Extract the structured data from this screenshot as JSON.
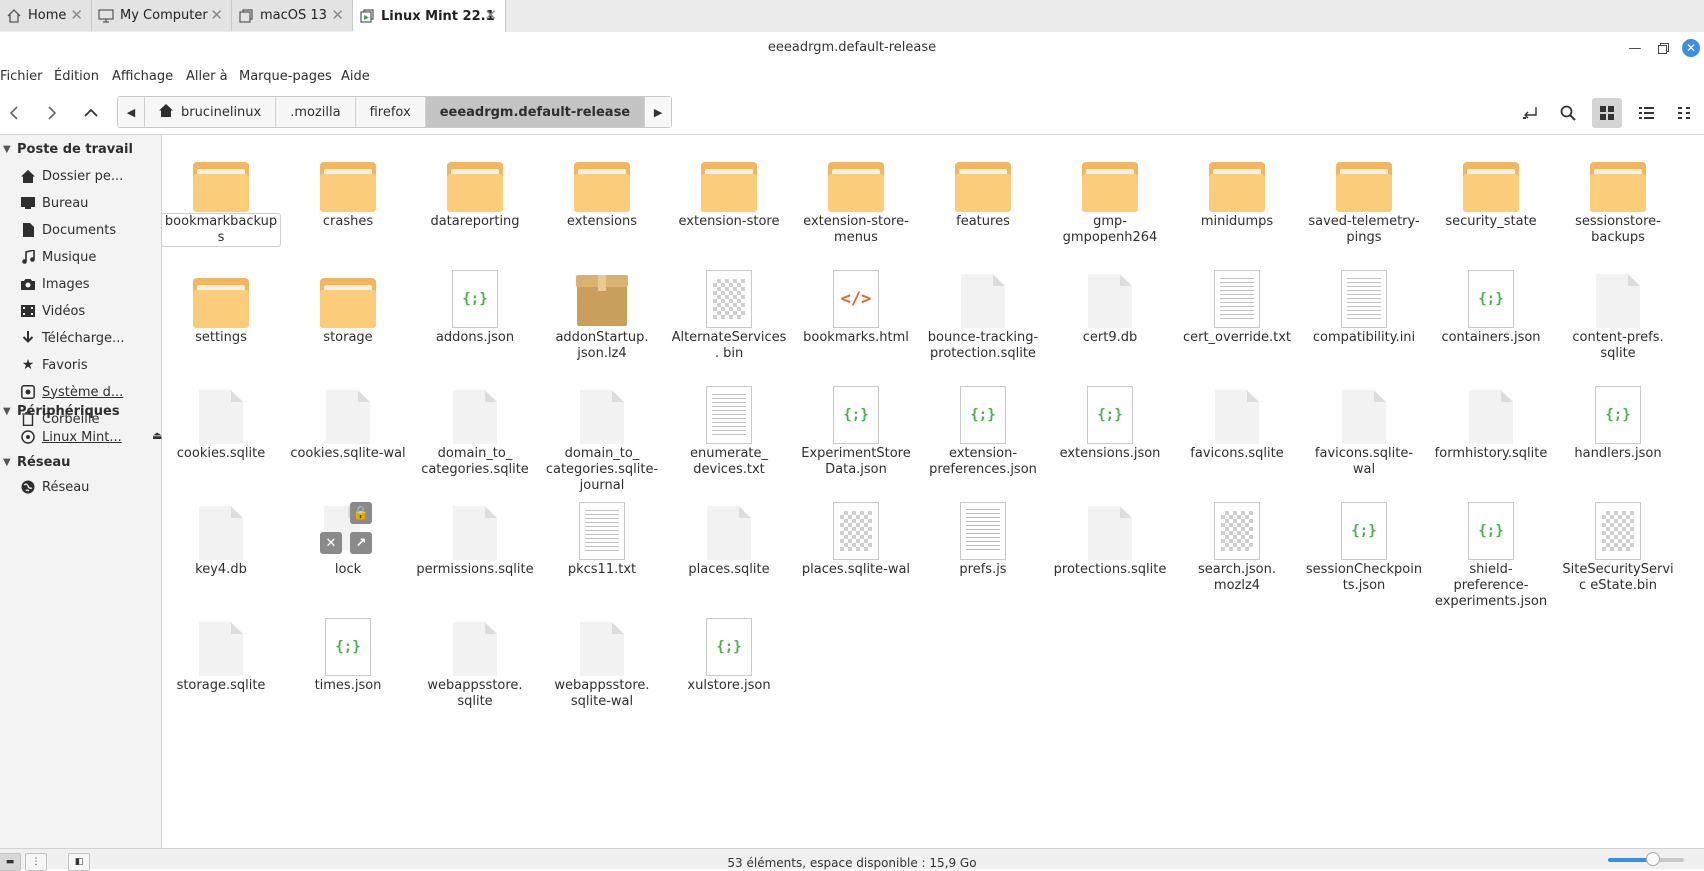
{
  "vm_tabs": [
    {
      "label": "Home",
      "icon": "home-icon"
    },
    {
      "label": "My Computer",
      "icon": "monitor-icon"
    },
    {
      "label": "macOS 13",
      "icon": "vm-icon"
    },
    {
      "label": "Linux Mint 22.1",
      "icon": "vm-running-icon"
    }
  ],
  "window": {
    "title": "eeeadrgm.default-release"
  },
  "menu": [
    "Fichier",
    "Édition",
    "Affichage",
    "Aller à",
    "Marque-pages",
    "Aide"
  ],
  "breadcrumbs": [
    "brucinelinux",
    ".mozilla",
    "firefox",
    "eeeadrgm.default-release"
  ],
  "sidebar": {
    "sections": [
      {
        "title": "Poste de travail",
        "items": [
          {
            "label": "Dossier pe...",
            "icon": "home-icon"
          },
          {
            "label": "Bureau",
            "icon": "desktop-icon"
          },
          {
            "label": "Documents",
            "icon": "document-icon"
          },
          {
            "label": "Musique",
            "icon": "music-icon"
          },
          {
            "label": "Images",
            "icon": "camera-icon"
          },
          {
            "label": "Vidéos",
            "icon": "video-icon"
          },
          {
            "label": "Télécharge...",
            "icon": "download-icon"
          },
          {
            "label": "Favoris",
            "icon": "star-icon"
          },
          {
            "label": "Système d...",
            "icon": "drive-icon"
          },
          {
            "label": "Corbeille",
            "icon": "trash-icon"
          }
        ]
      },
      {
        "title": "Périphériques",
        "items": [
          {
            "label": "Linux Mint...",
            "icon": "disc-icon"
          }
        ]
      },
      {
        "title": "Réseau",
        "items": [
          {
            "label": "Réseau",
            "icon": "network-icon"
          }
        ]
      }
    ]
  },
  "files": [
    {
      "name": "bookmarkbackups",
      "type": "folder"
    },
    {
      "name": "crashes",
      "type": "folder"
    },
    {
      "name": "datareporting",
      "type": "folder"
    },
    {
      "name": "extensions",
      "type": "folder"
    },
    {
      "name": "extension-store",
      "type": "folder"
    },
    {
      "name": "extension-store-menus",
      "type": "folder"
    },
    {
      "name": "features",
      "type": "folder"
    },
    {
      "name": "gmp-gmpopenh264",
      "type": "folder"
    },
    {
      "name": "minidumps",
      "type": "folder"
    },
    {
      "name": "saved-telemetry-pings",
      "type": "folder"
    },
    {
      "name": "security_state",
      "type": "folder"
    },
    {
      "name": "sessionstore-backups",
      "type": "folder"
    },
    {
      "name": "settings",
      "type": "folder"
    },
    {
      "name": "storage",
      "type": "folder"
    },
    {
      "name": "addons.json",
      "type": "json"
    },
    {
      "name": "addonStartup.json.lz4",
      "type": "archive"
    },
    {
      "name": "AlternateServices.bin",
      "type": "binary"
    },
    {
      "name": "bookmarks.html",
      "type": "html"
    },
    {
      "name": "bounce-tracking-protection.sqlite",
      "type": "blank"
    },
    {
      "name": "cert9.db",
      "type": "blank"
    },
    {
      "name": "cert_override.txt",
      "type": "text"
    },
    {
      "name": "compatibility.ini",
      "type": "text"
    },
    {
      "name": "containers.json",
      "type": "json"
    },
    {
      "name": "content-prefs.sqlite",
      "type": "blank"
    },
    {
      "name": "cookies.sqlite",
      "type": "blank"
    },
    {
      "name": "cookies.sqlite-wal",
      "type": "blank"
    },
    {
      "name": "domain_to_categories.sqlite",
      "type": "blank"
    },
    {
      "name": "domain_to_categories.sqlite-journal",
      "type": "blank"
    },
    {
      "name": "enumerate_devices.txt",
      "type": "text"
    },
    {
      "name": "ExperimentStoreData.json",
      "type": "json"
    },
    {
      "name": "extension-preferences.json",
      "type": "json"
    },
    {
      "name": "extensions.json",
      "type": "json"
    },
    {
      "name": "favicons.sqlite",
      "type": "blank"
    },
    {
      "name": "favicons.sqlite-wal",
      "type": "blank"
    },
    {
      "name": "formhistory.sqlite",
      "type": "blank"
    },
    {
      "name": "handlers.json",
      "type": "json"
    },
    {
      "name": "key4.db",
      "type": "blank"
    },
    {
      "name": "lock",
      "type": "lock"
    },
    {
      "name": "permissions.sqlite",
      "type": "blank"
    },
    {
      "name": "pkcs11.txt",
      "type": "text"
    },
    {
      "name": "places.sqlite",
      "type": "blank"
    },
    {
      "name": "places.sqlite-wal",
      "type": "binary"
    },
    {
      "name": "prefs.js",
      "type": "code"
    },
    {
      "name": "protections.sqlite",
      "type": "blank"
    },
    {
      "name": "search.json.mozlz4",
      "type": "binary"
    },
    {
      "name": "sessionCheckpoints.json",
      "type": "json"
    },
    {
      "name": "shield-preference-experiments.json",
      "type": "json"
    },
    {
      "name": "SiteSecurityServiceState.bin",
      "type": "binary"
    },
    {
      "name": "storage.sqlite",
      "type": "blank"
    },
    {
      "name": "times.json",
      "type": "json"
    },
    {
      "name": "webappsstore.sqlite",
      "type": "blank"
    },
    {
      "name": "webappsstore.sqlite-wal",
      "type": "blank"
    },
    {
      "name": "xulstore.json",
      "type": "json"
    }
  ],
  "display_names": {
    "bookmarkbackups": "bookmarkbackup s",
    "extension-store-menus": "extension-store- menus",
    "gmp-gmpopenh264": "gmp- gmpopenh264",
    "saved-telemetry-pings": "saved-telemetry- pings",
    "sessionstore-backups": "sessionstore- backups",
    "addonStartup.json.lz4": "addonStartup. json.lz4",
    "AlternateServices.bin": "AlternateServices. bin",
    "bounce-tracking-protection.sqlite": "bounce-tracking- protection.sqlite",
    "content-prefs.sqlite": "content-prefs. sqlite",
    "domain_to_categories.sqlite": "domain_to_ categories.sqlite",
    "domain_to_categories.sqlite-journal": "domain_to_ categories.sqlite- journal",
    "enumerate_devices.txt": "enumerate_ devices.txt",
    "ExperimentStoreData.json": "ExperimentStore Data.json",
    "extension-preferences.json": "extension- preferences.json",
    "search.json.mozlz4": "search.json. mozlz4",
    "sessionCheckpoints.json": "sessionCheckpoin ts.json",
    "shield-preference-experiments.json": "shield-preference- experiments.json",
    "SiteSecurityServiceState.bin": "SiteSecurityServic eState.bin",
    "webappsstore.sqlite": "webappsstore. sqlite",
    "webappsstore.sqlite-wal": "webappsstore. sqlite-wal"
  },
  "status": {
    "text": "53 éléments, espace disponible : 15,9 Go"
  },
  "colors": {
    "accent": "#3a8ee6",
    "folder": "#fbcc79",
    "json": "#4caf50",
    "html": "#e0642a"
  }
}
